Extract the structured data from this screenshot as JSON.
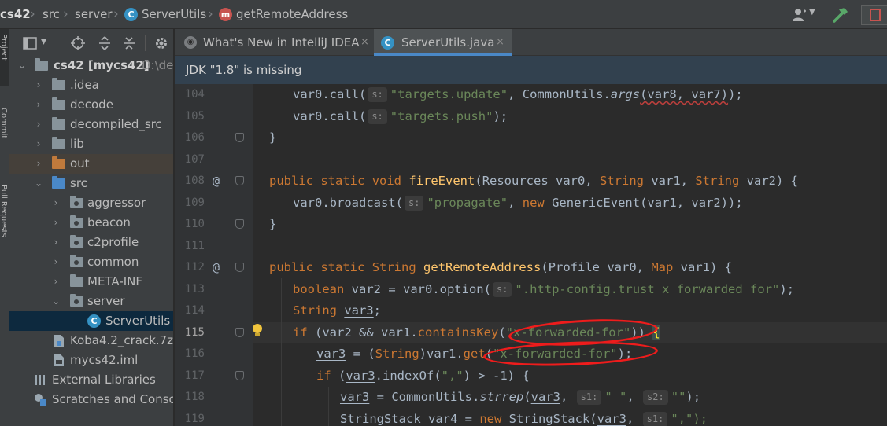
{
  "breadcrumb": {
    "project": "cs42",
    "src": "src",
    "server": "server",
    "class_name": "ServerUtils",
    "class_badge": "C",
    "method_name": "getRemoteAddress",
    "method_badge": "m"
  },
  "left_strip": {
    "project_label": "Project",
    "commit_label": "Commit",
    "pull_requests_label": "Pull Requests"
  },
  "project_tree": {
    "items": [
      {
        "label": "cs42 [mycs42]",
        "path": "D:\\dev",
        "expanded": true
      },
      {
        "label": ".idea"
      },
      {
        "label": "decode"
      },
      {
        "label": "decompiled_src"
      },
      {
        "label": "lib"
      },
      {
        "label": "out"
      },
      {
        "label": "src",
        "expanded": true
      },
      {
        "label": "aggressor"
      },
      {
        "label": "beacon"
      },
      {
        "label": "c2profile"
      },
      {
        "label": "common"
      },
      {
        "label": "META-INF"
      },
      {
        "label": "server",
        "expanded": true
      },
      {
        "label": "ServerUtils",
        "badge": "C"
      },
      {
        "label": "Koba4.2_crack.7z"
      },
      {
        "label": "mycs42.iml"
      },
      {
        "label": "External Libraries"
      },
      {
        "label": "Scratches and Consoles"
      }
    ]
  },
  "tabs": [
    {
      "label": "What's New in IntelliJ IDEA",
      "close": "×"
    },
    {
      "label": "ServerUtils.java",
      "close": "×",
      "active": true
    }
  ],
  "notice": "JDK \"1.8\" is missing",
  "editor": {
    "line_numbers": [
      "104",
      "105",
      "106",
      "107",
      "108",
      "109",
      "110",
      "111",
      "112",
      "113",
      "114",
      "115",
      "116",
      "117",
      "118",
      "119"
    ],
    "current_line": "115",
    "gutter_marks": {
      "108": "@",
      "112": "@"
    },
    "hints": {
      "s": "s:",
      "s1": "s1:",
      "s2": "s2:"
    },
    "tokens": {
      "var0_call": "var0.call(",
      "targets_update": "\"targets.update\"",
      "commonutils_args_pre": ", CommonUtils.",
      "args": "args",
      "args_params": "(var8, var7)",
      "end_semicolon": ");",
      "targets_push": "\"targets.push\"",
      "close_brace": "}",
      "public": "public",
      "static": "static",
      "void": "void",
      "fireEvent": "fireEvent",
      "fire_params_1": "(Resources var0, ",
      "String": "String",
      "fire_params_2": " var1, ",
      "fire_params_3": " var2) {",
      "broadcast": "var0.broadcast(",
      "propagate": "\"propagate\"",
      "comma_space": ", ",
      "new": "new",
      "generic_event": " GenericEvent(var1, var2));",
      "getRemoteAddress": "getRemoteAddress",
      "gra_params_1": "(Profile var0, ",
      "Map": "Map",
      "gra_params_2": " var1) {",
      "boolean": "boolean",
      "option_call": " var2 = var0.option(",
      "trust_str": "\".http-config.trust_x_forwarded_for\"",
      "var3": "var3",
      "semicolon": ";",
      "if": "if",
      "if_cond_1": " (var2 && var1.",
      "containsKey": "containsKey",
      "xff": "\"x-forwarded-for\"",
      "if_cond_2": ")",
      "open_brace": "{",
      "assign_eq": " = (",
      "get_call_pre": ")var1.",
      "get": "get",
      "open_paren": "(",
      "indexof_pre": ".indexOf(",
      "comma_str": "\",\"",
      "indexof_post": ") > -1) {",
      "strrep_pre": " = CommonUtils.",
      "strrep": "strrep",
      "comma": ",",
      "space_str": "\" \"",
      "empty_str": "\"\"",
      "stringstack_pre": "StringStack var4 = ",
      "stringstack_post": " StringStack(",
      "stringstack_end": "\",\");"
    }
  },
  "colors": {
    "keyword": "#cc7832",
    "string": "#6a8759",
    "function": "#ffc66d",
    "annotation_red": "#ee1c1c",
    "accent_blue": "#4a88c7"
  }
}
